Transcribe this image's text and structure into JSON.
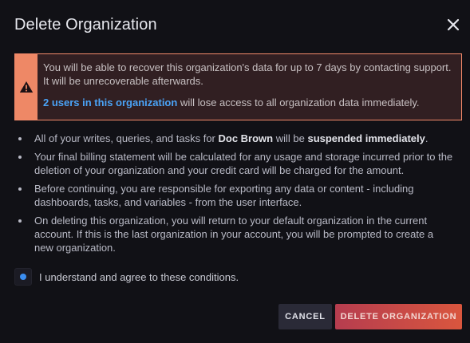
{
  "dialog": {
    "title": "Delete Organization",
    "close_icon": "close-icon"
  },
  "alert": {
    "icon": "warning-icon",
    "line1": "You will be able to recover this organization's data for up to 7 days by contacting support. It will be unrecoverable afterwards.",
    "users_link": "2 users in this organization",
    "users_suffix": " will lose access to all organization data immediately.",
    "colors": {
      "stripe": "#ee8866",
      "border": "#f48a6a",
      "background": "#311f22",
      "link": "#4aa3f7"
    }
  },
  "bullets": {
    "b1_pre": "All of your writes, queries, and tasks for ",
    "b1_name": "Doc Brown",
    "b1_mid": " will be ",
    "b1_strong": "suspended immediately",
    "b1_end": ".",
    "b2": "Your final billing statement will be calculated for any usage and storage incurred prior to the deletion of your organization and your credit card will be charged for the amount.",
    "b3": "Before continuing, you are responsible for exporting any data or content - including dashboards, tasks, and variables - from the user interface.",
    "b4": "On deleting this organization, you will return to your default organization in the current account. If this is the last organization in your account, you will be prompted to create a new organization."
  },
  "agree": {
    "checked": true,
    "label": "I understand and agree to these conditions."
  },
  "actions": {
    "cancel_label": "CANCEL",
    "delete_label": "DELETE ORGANIZATION",
    "colors": {
      "cancel_bg": "#2a2a37",
      "delete_from": "#b63d4f",
      "delete_to": "#d9563e"
    }
  }
}
